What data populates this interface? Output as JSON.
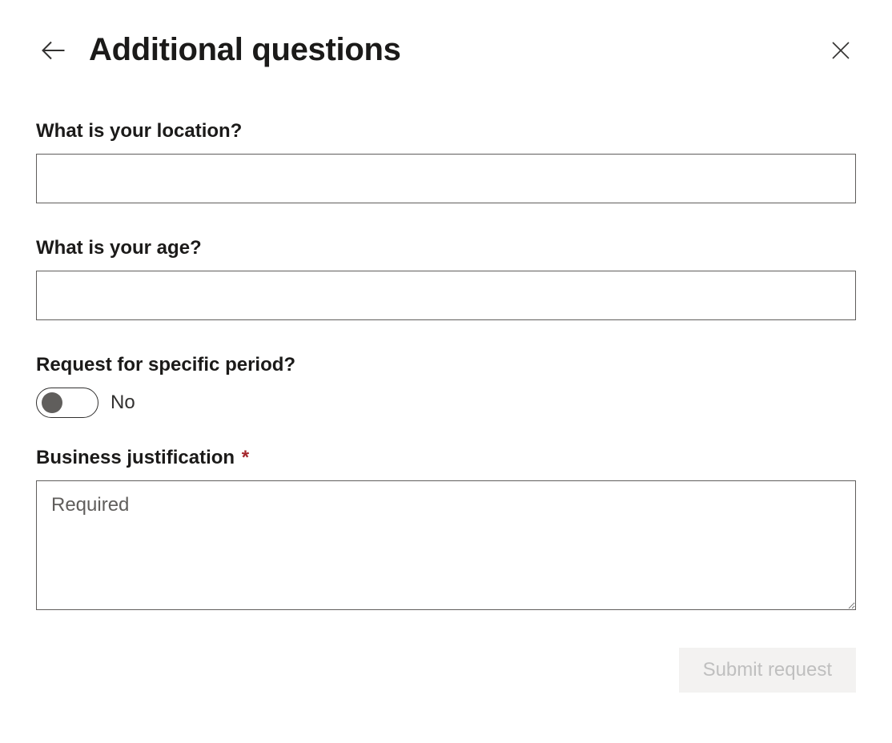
{
  "header": {
    "title": "Additional questions"
  },
  "form": {
    "location": {
      "label": "What is your location?",
      "value": ""
    },
    "age": {
      "label": "What is your age?",
      "value": ""
    },
    "period": {
      "label": "Request for specific period?",
      "state_label": "No"
    },
    "justification": {
      "label": "Business justification",
      "required_marker": "*",
      "placeholder": "Required",
      "value": ""
    }
  },
  "actions": {
    "submit_label": "Submit request"
  }
}
